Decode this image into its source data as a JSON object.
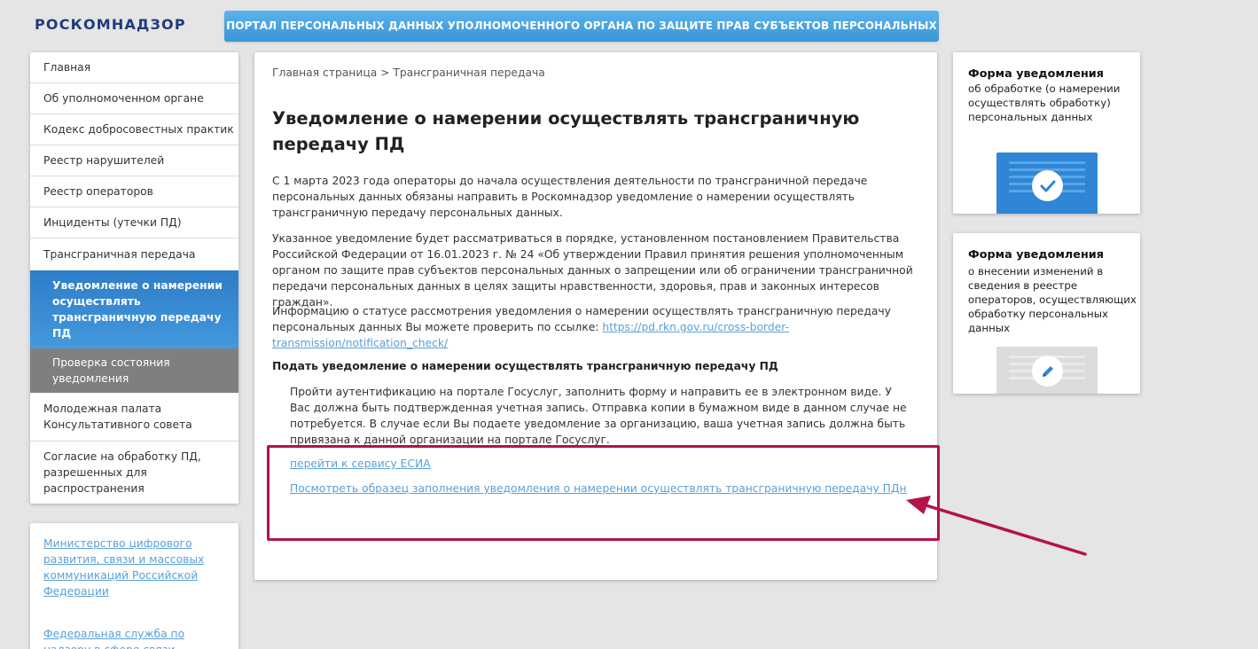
{
  "header": {
    "logo": "РОСКОМНАДЗОР",
    "portal_title": "ПОРТАЛ ПЕРСОНАЛЬНЫХ ДАННЫХ УПОЛНОМОЧЕННОГО ОРГАНА ПО ЗАЩИТЕ ПРАВ СУБЪЕКТОВ ПЕРСОНАЛЬНЫХ ДАННЫХ"
  },
  "sidebar": {
    "items": [
      {
        "label": "Главная"
      },
      {
        "label": "Об уполномоченном органе"
      },
      {
        "label": "Кодекс добросовестных практик"
      },
      {
        "label": "Реестр нарушителей"
      },
      {
        "label": "Реестр операторов"
      },
      {
        "label": "Инциденты (утечки ПД)"
      },
      {
        "label": "Трансграничная передача"
      },
      {
        "label": "Уведомление о намерении осуществлять трансграничную передачу ПД"
      },
      {
        "label": "Проверка состояния уведомления"
      },
      {
        "label": "Молодежная палата Консультативного совета"
      },
      {
        "label": "Согласие на обработку ПД, разрешенных для распространения"
      }
    ],
    "links": [
      {
        "label": "Министерство цифрового развития, связи и массовых коммуникаций Российской Федерации"
      },
      {
        "label": "Федеральная служба по надзору в сфере связи"
      }
    ]
  },
  "main": {
    "breadcrumb": "Главная страница > Трансграничная передача",
    "title": "Уведомление о намерении осуществлять трансграничную передачу ПД",
    "para1": "С 1 марта 2023 года операторы до начала осуществления деятельности по трансграничной передаче персональных данных обязаны направить в Роскомнадзор уведомление о намерении осуществлять трансграничную передачу персональных данных.",
    "para2": "Указанное уведомление будет рассматриваться в порядке, установленном постановлением Правительства Российской Федерации от 16.01.2023 г. № 24 «Об утверждении Правил принятия решения уполномоченным органом по защите прав субъектов персональных данных о запрещении или об ограничении трансграничной передачи персональных данных в целях защиты нравственности, здоровья, прав и законных интересов граждан».",
    "para3_text": "Информацию о статусе рассмотрения уведомления о намерении осуществлять трансграничную передачу персональных данных Вы можете проверить по ссылке: ",
    "para3_link": "https://pd.rkn.gov.ru/cross-border-transmission/notification_check/",
    "subheading": "Подать уведомление о намерении осуществлять трансграничную передачу ПД",
    "instructions": "Пройти аутентификацию на портале Госуслуг, заполнить форму и направить ее в электронном виде. У Вас должна быть подтвержденная учетная запись. Отправка копии в бумажном виде в данном случае не потребуется. В случае если Вы подаете уведомление за организацию, ваша учетная запись должна быть привязана к данной организации на портале Госуслуг.",
    "link_esia": "перейти к сервису ЕСИА",
    "link_sample": "Посмотреть образец заполнения уведомления о намерении осуществлять трансграничную передачу ПДн"
  },
  "cards": [
    {
      "title": "Форма уведомления",
      "text": "об обработке (о намерении осуществлять обработку) персональных данных",
      "icon": "checkmark-icon"
    },
    {
      "title": "Форма уведомления",
      "text": "о внесении изменений в сведения в реестре операторов, осуществляющих обработку персональных данных",
      "icon": "pencil-icon"
    }
  ],
  "colors": {
    "brand_blue": "#1f3c78",
    "link": "#5aa0d8",
    "active_nav": "#3a8bd4",
    "highlight": "#b5124a"
  }
}
